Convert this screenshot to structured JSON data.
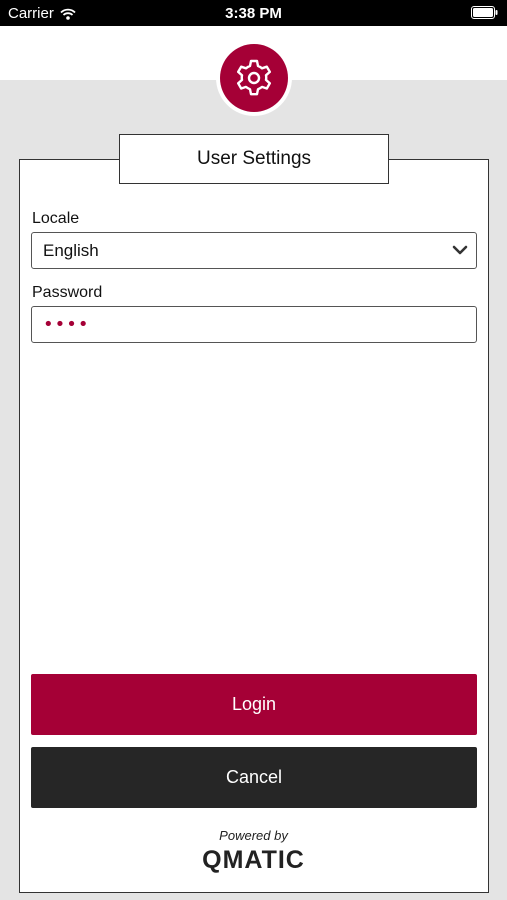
{
  "status_bar": {
    "carrier": "Carrier",
    "time": "3:38 PM",
    "icons": [
      "wifi-icon",
      "battery-icon"
    ]
  },
  "header": {
    "icon": "gear-icon",
    "accent_color": "#a50036"
  },
  "dialog": {
    "title": "User Settings",
    "locale": {
      "label": "Locale",
      "value": "English",
      "icon": "chevron-down-icon"
    },
    "password": {
      "label": "Password",
      "value": "••••"
    },
    "buttons": {
      "login_label": "Login",
      "login_color": "#a50036",
      "cancel_label": "Cancel",
      "cancel_color": "#262626"
    }
  },
  "footer": {
    "powered_by": "Powered by",
    "brand": "QMATIC"
  }
}
